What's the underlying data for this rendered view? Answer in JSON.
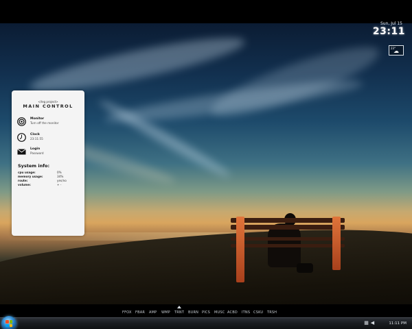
{
  "clock_widget": {
    "date": "Sun, Jul 15",
    "time": "23:11"
  },
  "weather_widget": {
    "temperature": "23°",
    "icon": "cloud-sun-icon"
  },
  "main_control": {
    "subtitle": "</leg project>",
    "title": "MAIN CONTROL",
    "items": [
      {
        "name": "monitor",
        "icon": "target-icon",
        "label": "Monitor",
        "sub": "Turn off the monitor"
      },
      {
        "name": "clock",
        "icon": "clock-icon",
        "label": "Clock",
        "sub": "23:11:55"
      },
      {
        "name": "login",
        "icon": "envelope-icon",
        "label": "Login",
        "sub": "Password"
      }
    ],
    "system_info": {
      "heading": "System info:",
      "stats": [
        {
          "key": "cpu usage:",
          "value": "0%"
        },
        {
          "key": "memory usage:",
          "value": "34%"
        },
        {
          "key": "route:",
          "value": "yes/no"
        },
        {
          "key": "volume:",
          "value": "+ -"
        }
      ]
    }
  },
  "dock": {
    "items": [
      "FFOX",
      "FBAR",
      "AMP",
      "WMP",
      "TRNT",
      "BURN",
      "PICS",
      "MUSC",
      "ACBD",
      "ITNS",
      "CSKU",
      "TRSH"
    ],
    "active_index": 4
  },
  "taskbar": {
    "start_icon": "windows-orb-icon",
    "time": "11:11 PM"
  },
  "colors": {
    "panel_bg": "#f4f4f4",
    "taskbar": "#1a1d21",
    "bench_legs": "#e0743a"
  }
}
